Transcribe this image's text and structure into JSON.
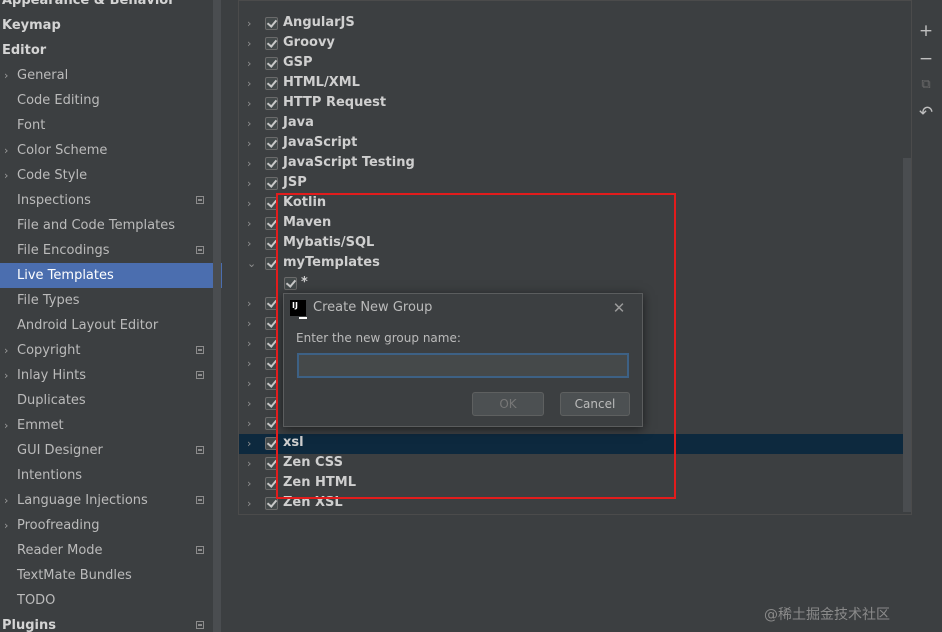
{
  "sidebar": {
    "items": [
      {
        "label": "Appearance & Behavior",
        "type": "header"
      },
      {
        "label": "Keymap",
        "type": "header"
      },
      {
        "label": "Editor",
        "type": "header"
      },
      {
        "label": "General",
        "expandable": true
      },
      {
        "label": "Code Editing"
      },
      {
        "label": "Font"
      },
      {
        "label": "Color Scheme",
        "expandable": true
      },
      {
        "label": "Code Style",
        "expandable": true
      },
      {
        "label": "Inspections",
        "badge": true
      },
      {
        "label": "File and Code Templates"
      },
      {
        "label": "File Encodings",
        "badge": true
      },
      {
        "label": "Live Templates",
        "selected": true
      },
      {
        "label": "File Types"
      },
      {
        "label": "Android Layout Editor"
      },
      {
        "label": "Copyright",
        "expandable": true,
        "badge": true
      },
      {
        "label": "Inlay Hints",
        "expandable": true,
        "badge": true
      },
      {
        "label": "Duplicates"
      },
      {
        "label": "Emmet",
        "expandable": true
      },
      {
        "label": "GUI Designer",
        "badge": true
      },
      {
        "label": "Intentions"
      },
      {
        "label": "Language Injections",
        "expandable": true,
        "badge": true
      },
      {
        "label": "Proofreading",
        "expandable": true
      },
      {
        "label": "Reader Mode",
        "badge": true
      },
      {
        "label": "TextMate Bundles"
      },
      {
        "label": "TODO"
      },
      {
        "label": "Plugins",
        "type": "header",
        "badge": true
      }
    ]
  },
  "tree": {
    "rows": [
      {
        "label": "AngularJS",
        "checked": true,
        "expanded": false
      },
      {
        "label": "Groovy",
        "checked": true,
        "expanded": false
      },
      {
        "label": "GSP",
        "checked": true,
        "expanded": false
      },
      {
        "label": "HTML/XML",
        "checked": true,
        "expanded": false
      },
      {
        "label": "HTTP Request",
        "checked": true,
        "expanded": false
      },
      {
        "label": "Java",
        "checked": true,
        "expanded": false
      },
      {
        "label": "JavaScript",
        "checked": true,
        "expanded": false
      },
      {
        "label": "JavaScript Testing",
        "checked": true,
        "expanded": false
      },
      {
        "label": "JSP",
        "checked": true,
        "expanded": false
      },
      {
        "label": "Kotlin",
        "checked": true,
        "expanded": false
      },
      {
        "label": "Maven",
        "checked": true,
        "expanded": false
      },
      {
        "label": "Mybatis/SQL",
        "checked": true,
        "expanded": false
      },
      {
        "label": "myTemplates",
        "checked": true,
        "expanded": true
      },
      {
        "label": "*",
        "checked": true,
        "child": true
      },
      {
        "label": "",
        "checked": true,
        "expanded": false
      },
      {
        "label": "",
        "checked": true,
        "expanded": false
      },
      {
        "label": "",
        "checked": true,
        "expanded": false
      },
      {
        "label": "",
        "checked": true,
        "expanded": false
      },
      {
        "label": "",
        "checked": true,
        "expanded": false
      },
      {
        "label": "",
        "checked": true,
        "expanded": false
      },
      {
        "label": "",
        "checked": true,
        "expanded": false
      },
      {
        "label": "xsl",
        "checked": true,
        "expanded": false,
        "selected": true
      },
      {
        "label": "Zen CSS",
        "checked": true,
        "expanded": false
      },
      {
        "label": "Zen HTML",
        "checked": true,
        "expanded": false
      },
      {
        "label": "Zen XSL",
        "checked": true,
        "expanded": false
      }
    ]
  },
  "toolbar": {
    "add_icon": "+",
    "remove_icon": "−",
    "copy_icon": "⧉",
    "restore_icon": "↶"
  },
  "dialog": {
    "title": "Create New Group",
    "prompt": "Enter the new group name:",
    "input_value": "",
    "ok_label": "OK",
    "cancel_label": "Cancel",
    "close_icon": "✕"
  },
  "watermark": "@稀土掘金技术社区",
  "colors": {
    "background": "#3c3f41",
    "selection": "#4b6eaf",
    "tree_selection": "#0d293e",
    "annotation": "#e21c1c",
    "input_focus": "#3d6185"
  }
}
